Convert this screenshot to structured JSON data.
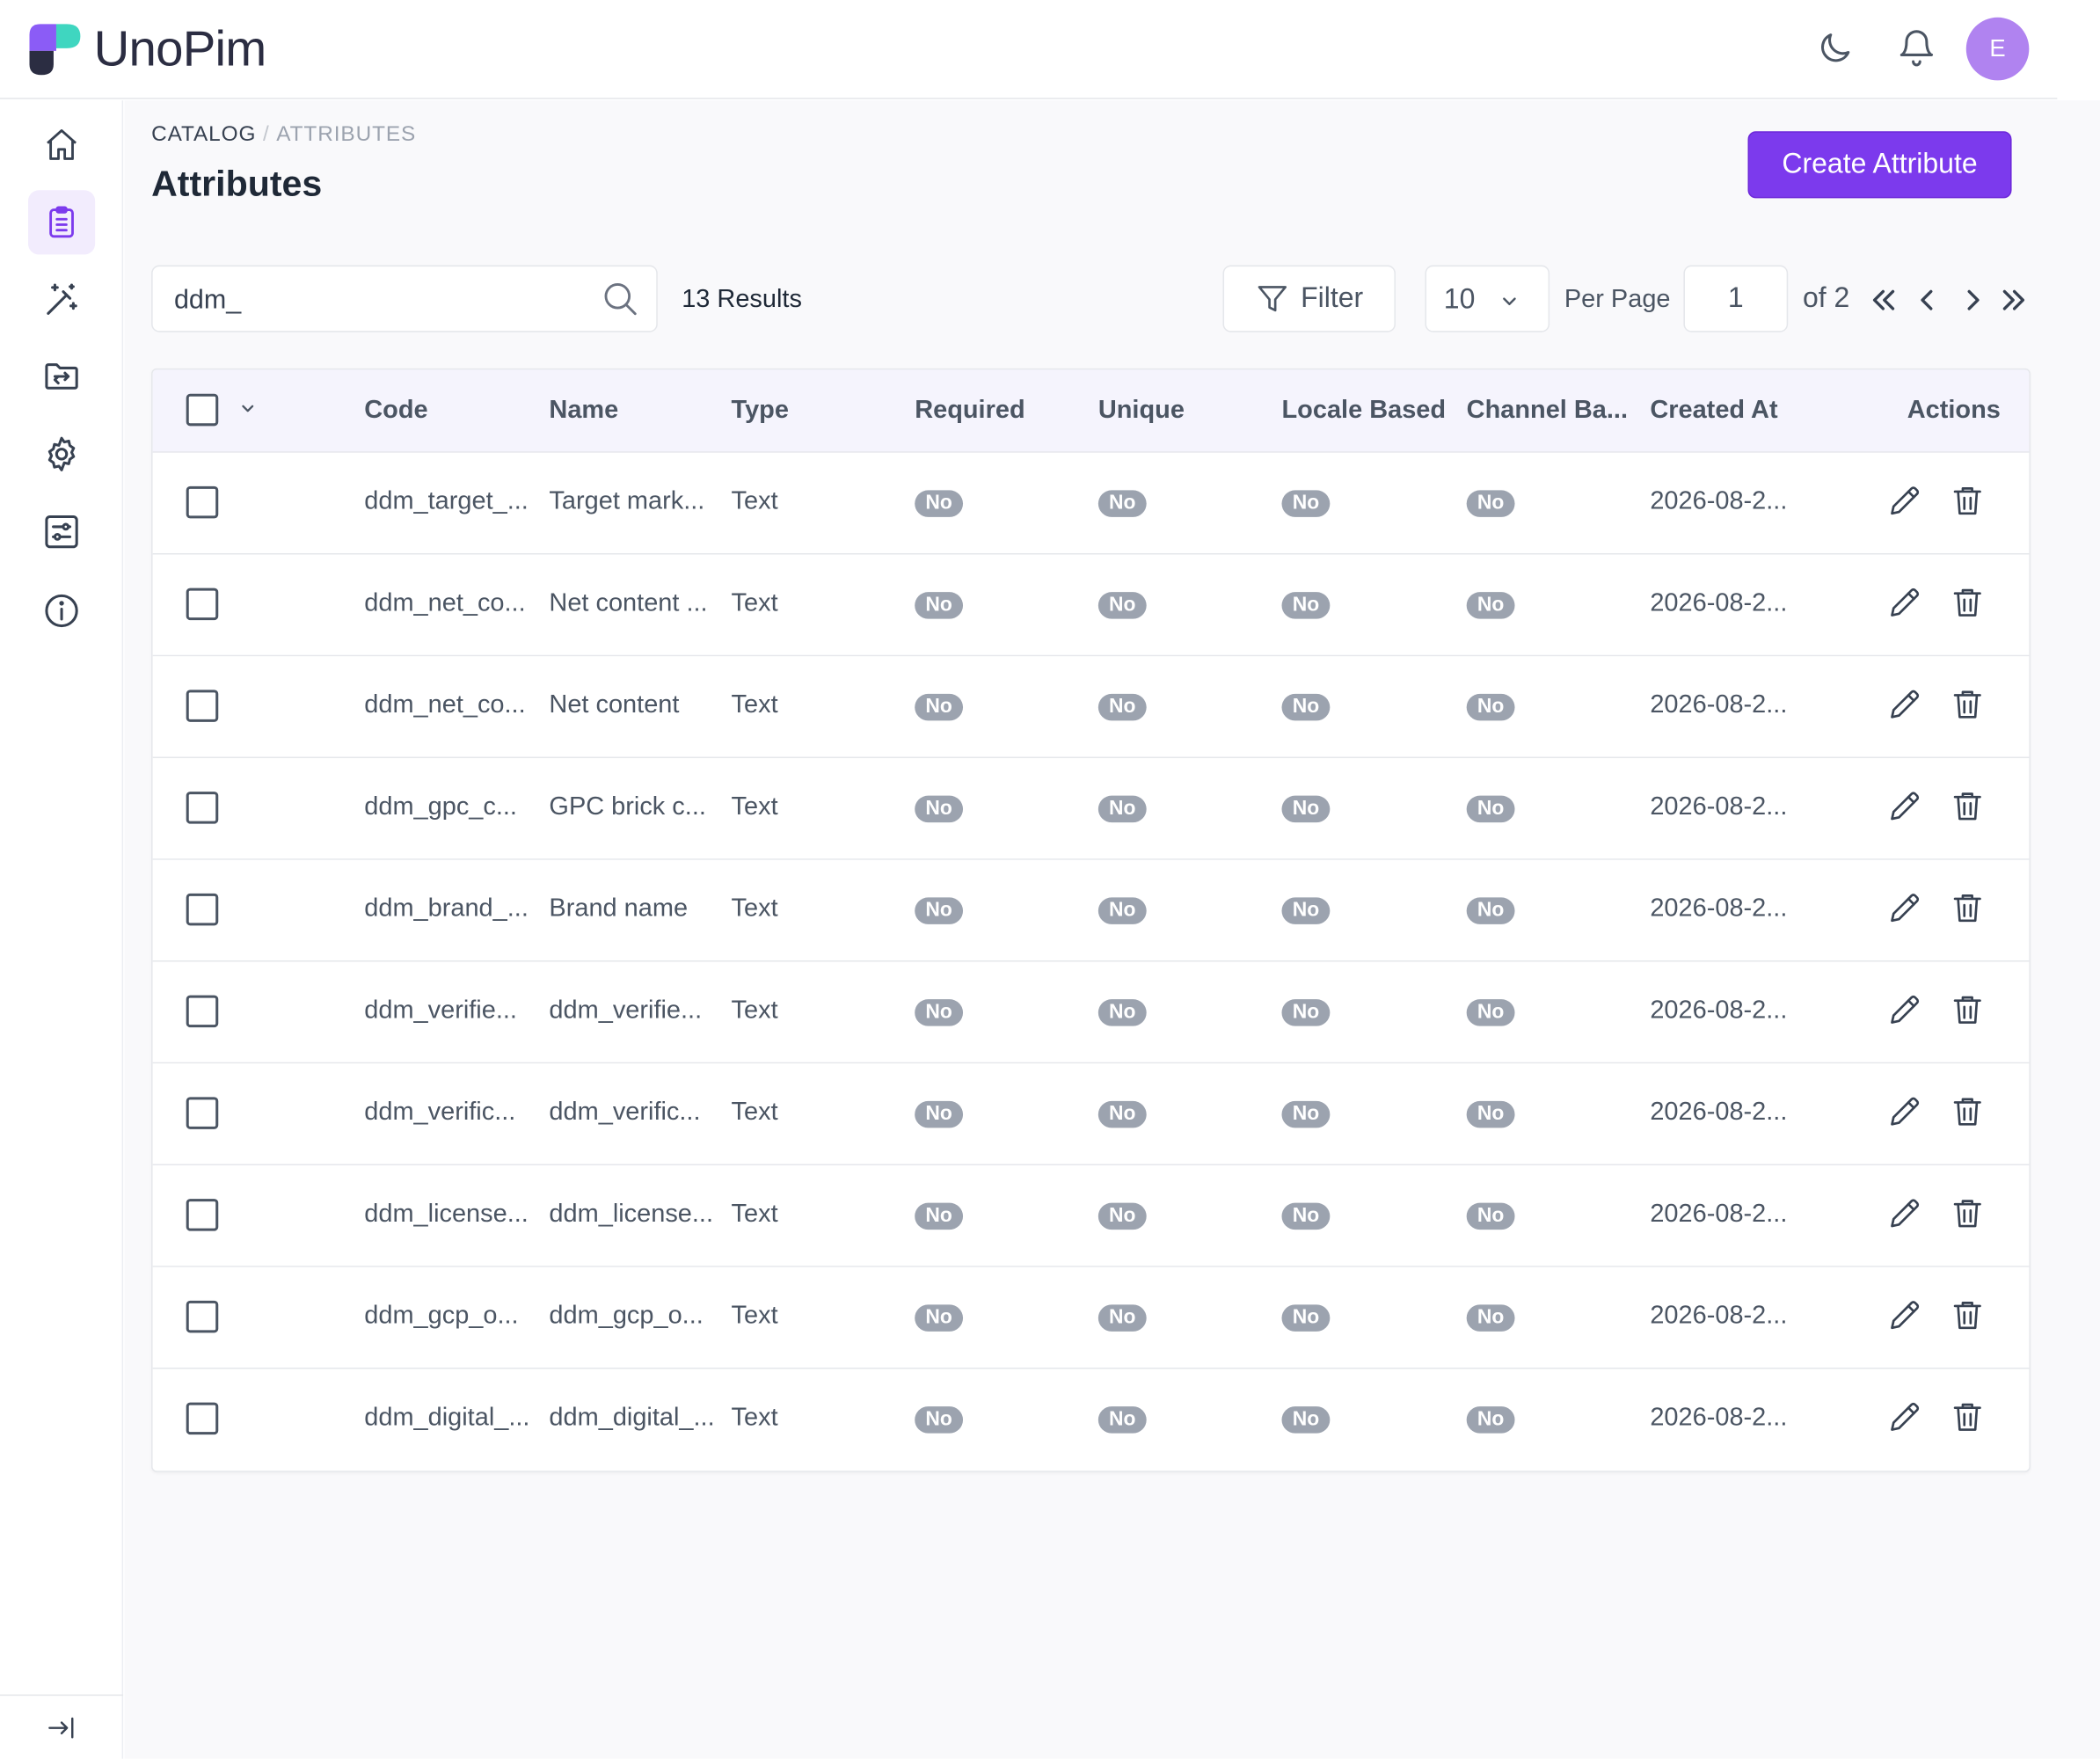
{
  "app": {
    "name": "UnoPim",
    "user_initial": "E"
  },
  "colors": {
    "accent": "#7c3aed",
    "badge": "#9ca3af",
    "active_nav_bg": "#f2ecfd"
  },
  "header": {
    "icons": [
      "moon-icon",
      "bell-icon"
    ]
  },
  "sidebar": {
    "items": [
      {
        "icon": "home-icon",
        "active": false
      },
      {
        "icon": "clipboard-list-icon",
        "active": true
      },
      {
        "icon": "magic-wand-icon",
        "active": false
      },
      {
        "icon": "folder-transfer-icon",
        "active": false
      },
      {
        "icon": "gear-icon",
        "active": false
      },
      {
        "icon": "sliders-icon",
        "active": false
      },
      {
        "icon": "info-icon",
        "active": false
      }
    ],
    "collapse_icon": "collapse-arrow-icon"
  },
  "breadcrumb": {
    "items": [
      "CATALOG",
      "ATTRIBUTES"
    ],
    "separator": "/"
  },
  "page": {
    "title": "Attributes",
    "create_button": "Create Attribute"
  },
  "toolbar": {
    "search_value": "ddm_",
    "results": "13 Results",
    "filter_label": "Filter",
    "per_page_value": "10",
    "per_page_label": "Per Page",
    "current_page": "1",
    "of_total": "of 2"
  },
  "table": {
    "columns": [
      "Code",
      "Name",
      "Type",
      "Required",
      "Unique",
      "Locale Based",
      "Channel Ba...",
      "Created At",
      "Actions"
    ],
    "rows": [
      {
        "code": "ddm_target_...",
        "name": "Target mark...",
        "type": "Text",
        "required": "No",
        "unique": "No",
        "locale_based": "No",
        "channel_based": "No",
        "created_at": "2026-08-2..."
      },
      {
        "code": "ddm_net_co...",
        "name": "Net content ...",
        "type": "Text",
        "required": "No",
        "unique": "No",
        "locale_based": "No",
        "channel_based": "No",
        "created_at": "2026-08-2..."
      },
      {
        "code": "ddm_net_co...",
        "name": "Net content",
        "type": "Text",
        "required": "No",
        "unique": "No",
        "locale_based": "No",
        "channel_based": "No",
        "created_at": "2026-08-2..."
      },
      {
        "code": "ddm_gpc_c...",
        "name": "GPC brick c...",
        "type": "Text",
        "required": "No",
        "unique": "No",
        "locale_based": "No",
        "channel_based": "No",
        "created_at": "2026-08-2..."
      },
      {
        "code": "ddm_brand_...",
        "name": "Brand name",
        "type": "Text",
        "required": "No",
        "unique": "No",
        "locale_based": "No",
        "channel_based": "No",
        "created_at": "2026-08-2..."
      },
      {
        "code": "ddm_verifie...",
        "name": "ddm_verifie...",
        "type": "Text",
        "required": "No",
        "unique": "No",
        "locale_based": "No",
        "channel_based": "No",
        "created_at": "2026-08-2..."
      },
      {
        "code": "ddm_verific...",
        "name": "ddm_verific...",
        "type": "Text",
        "required": "No",
        "unique": "No",
        "locale_based": "No",
        "channel_based": "No",
        "created_at": "2026-08-2..."
      },
      {
        "code": "ddm_license...",
        "name": "ddm_license...",
        "type": "Text",
        "required": "No",
        "unique": "No",
        "locale_based": "No",
        "channel_based": "No",
        "created_at": "2026-08-2..."
      },
      {
        "code": "ddm_gcp_o...",
        "name": "ddm_gcp_o...",
        "type": "Text",
        "required": "No",
        "unique": "No",
        "locale_based": "No",
        "channel_based": "No",
        "created_at": "2026-08-2..."
      },
      {
        "code": "ddm_digital_...",
        "name": "ddm_digital_...",
        "type": "Text",
        "required": "No",
        "unique": "No",
        "locale_based": "No",
        "channel_based": "No",
        "created_at": "2026-08-2..."
      }
    ]
  }
}
